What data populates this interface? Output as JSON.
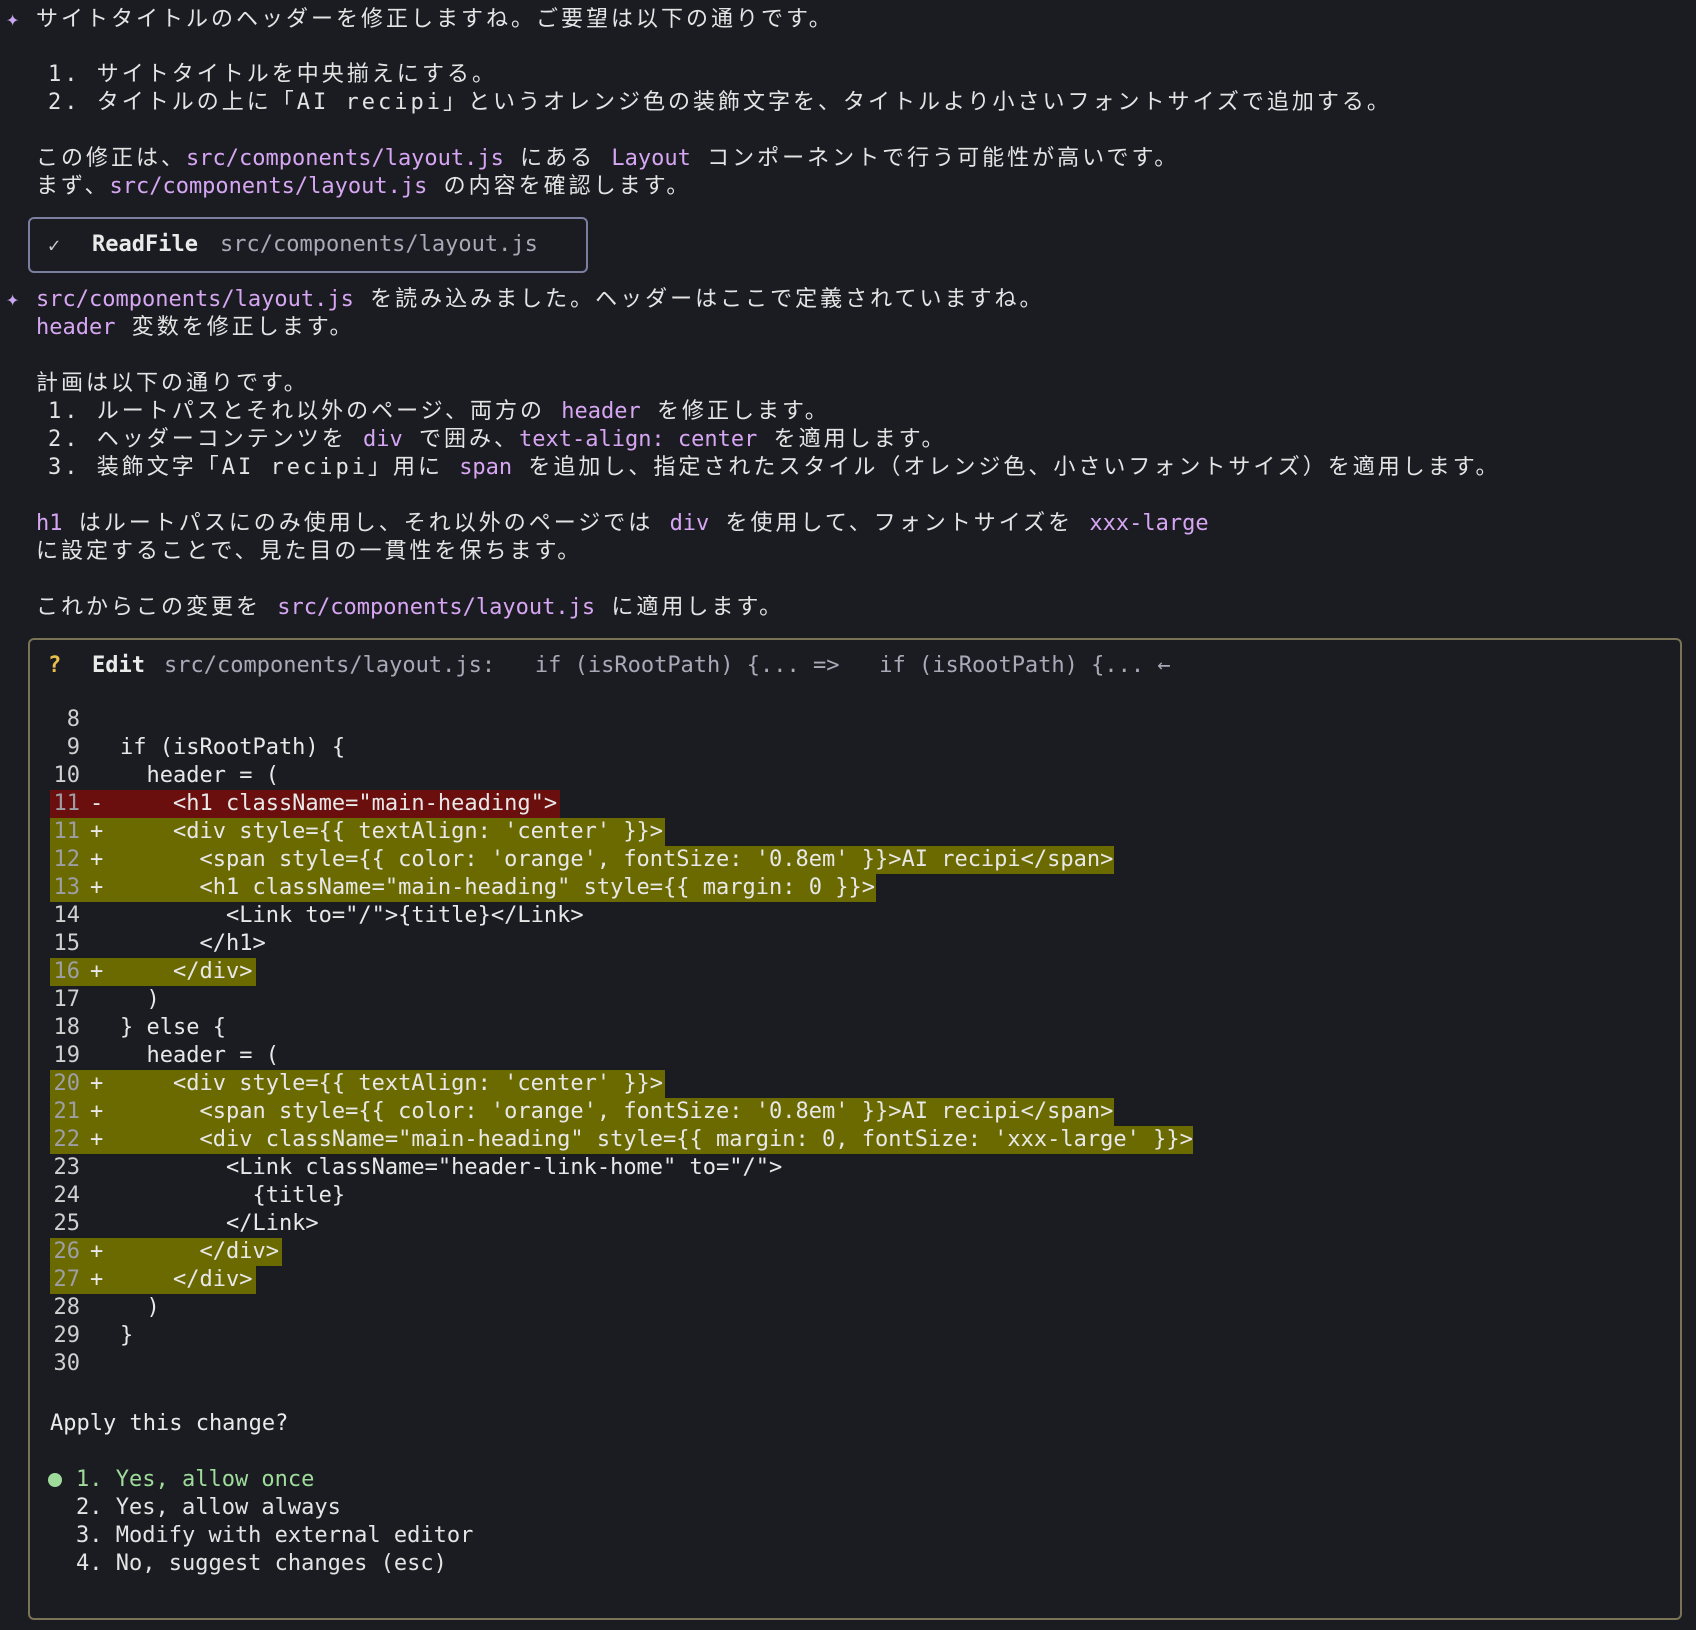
{
  "intro": {
    "line1": "サイトタイトルのヘッダーを修正しますね。ご要望は以下の通りです。",
    "list": [
      "1. サイトタイトルを中央揃えにする。",
      "2. タイトルの上に「AI recipi」というオレンジ色の装飾文字を、タイトルより小さいフォントサイズで追加する。"
    ],
    "line4_a": "この修正は、",
    "line4_code1": "src/components/layout.js",
    "line4_b": " にある ",
    "line4_code2": "Layout",
    "line4_c": " コンポーネントで行う可能性が高いです。",
    "line5_a": "まず、",
    "line5_code": "src/components/layout.js",
    "line5_b": " の内容を確認します。"
  },
  "readfile": {
    "tool": "ReadFile",
    "path": "src/components/layout.js"
  },
  "response": {
    "l1_code": "src/components/layout.js",
    "l1_text": " を読み込みました。ヘッダーはここで定義されていますね。",
    "l2_code": "header",
    "l2_text": " 変数を修正します。",
    "plan": "計画は以下の通りです。",
    "p1_a": "1. ルートパスとそれ以外のページ、両方の ",
    "p1_code": "header",
    "p1_b": " を修正します。",
    "p2_a": "2. ヘッダーコンテンツを ",
    "p2_code1": "div",
    "p2_b": " で囲み、",
    "p2_code2": "text-align: center",
    "p2_c": " を適用します。",
    "p3_a": "3. 装飾文字「AI recipi」用に ",
    "p3_code": "span",
    "p3_b": " を追加し、指定されたスタイル（オレンジ色、小さいフォントサイズ）を適用します。",
    "h1_code": "h1",
    "h1_a": " はルートパスにのみ使用し、それ以外のページでは ",
    "h1_code2": "div",
    "h1_b": " を使用して、フォントサイズを ",
    "h1_code3": "xxx-large",
    "h1_c": "に設定することで、見た目の一貫性を保ちます。",
    "apply_a": "これからこの変更を ",
    "apply_code": "src/components/layout.js",
    "apply_b": " に適用します。"
  },
  "edit": {
    "q": "?",
    "tool": "Edit",
    "desc": "src/components/layout.js:   if (isRootPath) {... =>   if (isRootPath) {... ←",
    "lines": [
      {
        "n": "8",
        "m": " ",
        "t": "",
        "code": ""
      },
      {
        "n": "9",
        "m": " ",
        "t": "",
        "code": "if (isRootPath) {"
      },
      {
        "n": "10",
        "m": " ",
        "t": "",
        "code": "  header = ("
      },
      {
        "n": "11",
        "m": "-",
        "t": "del",
        "code": "    <h1 className=\"main-heading\">"
      },
      {
        "n": "11",
        "m": "+",
        "t": "add",
        "code": "    <div style={{ textAlign: 'center' }}>"
      },
      {
        "n": "12",
        "m": "+",
        "t": "add",
        "code": "      <span style={{ color: 'orange', fontSize: '0.8em' }}>AI recipi</span>"
      },
      {
        "n": "13",
        "m": "+",
        "t": "add",
        "code": "      <h1 className=\"main-heading\" style={{ margin: 0 }}>"
      },
      {
        "n": "14",
        "m": " ",
        "t": "",
        "code": "        <Link to=\"/\">{title}</Link>"
      },
      {
        "n": "15",
        "m": " ",
        "t": "",
        "code": "      </h1>"
      },
      {
        "n": "16",
        "m": "+",
        "t": "add",
        "code": "    </div>"
      },
      {
        "n": "17",
        "m": " ",
        "t": "",
        "code": "  )"
      },
      {
        "n": "18",
        "m": " ",
        "t": "",
        "code": "} else {"
      },
      {
        "n": "19",
        "m": " ",
        "t": "",
        "code": "  header = ("
      },
      {
        "n": "20",
        "m": "+",
        "t": "add",
        "code": "    <div style={{ textAlign: 'center' }}>"
      },
      {
        "n": "21",
        "m": "+",
        "t": "add",
        "code": "      <span style={{ color: 'orange', fontSize: '0.8em' }}>AI recipi</span>"
      },
      {
        "n": "22",
        "m": "+",
        "t": "add",
        "code": "      <div className=\"main-heading\" style={{ margin: 0, fontSize: 'xxx-large' }}>"
      },
      {
        "n": "23",
        "m": " ",
        "t": "",
        "code": "        <Link className=\"header-link-home\" to=\"/\">"
      },
      {
        "n": "24",
        "m": " ",
        "t": "",
        "code": "          {title}"
      },
      {
        "n": "25",
        "m": " ",
        "t": "",
        "code": "        </Link>"
      },
      {
        "n": "26",
        "m": "+",
        "t": "add",
        "code": "      </div>"
      },
      {
        "n": "27",
        "m": "+",
        "t": "add",
        "code": "    </div>"
      },
      {
        "n": "28",
        "m": " ",
        "t": "",
        "code": "  )"
      },
      {
        "n": "29",
        "m": " ",
        "t": "",
        "code": "}"
      },
      {
        "n": "30",
        "m": " ",
        "t": "",
        "code": ""
      }
    ],
    "question": "Apply this change?",
    "options": [
      "1. Yes, allow once",
      "2. Yes, allow always",
      "3. Modify with external editor",
      "4. No, suggest changes (esc)"
    ]
  }
}
